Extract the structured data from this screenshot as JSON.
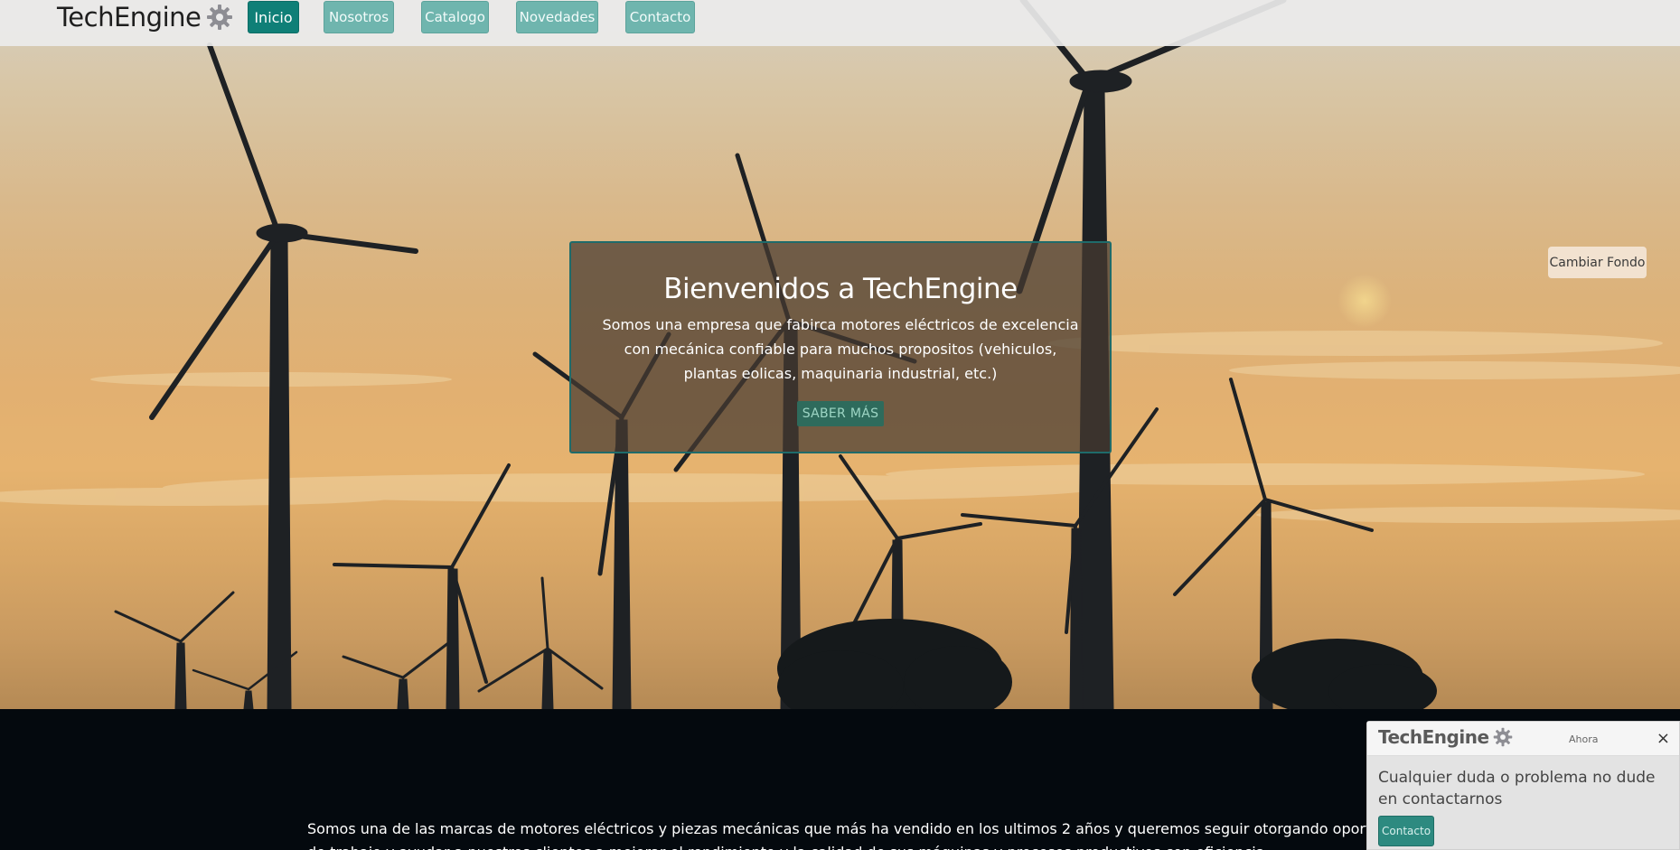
{
  "brand": {
    "name": "TechEngine",
    "icon": "gear-icon"
  },
  "nav": {
    "items": [
      {
        "label": "Inicio",
        "active": true
      },
      {
        "label": "Nosotros",
        "active": false
      },
      {
        "label": "Catalogo",
        "active": false
      },
      {
        "label": "Novedades",
        "active": false
      },
      {
        "label": "Contacto",
        "active": false
      }
    ]
  },
  "hero": {
    "title": "Bienvenidos a TechEngine",
    "description": "Somos una empresa que fabirca motores eléctricos de excelencia con mecánica confiable para muchos propositos (vehiculos, plantas eolicas, maquinaria industrial, etc.)",
    "cta_label": "SABER MÁS",
    "change_bg_label": "Cambiar Fondo"
  },
  "about": {
    "line1": "Somos una de las marcas de motores eléctricos y piezas mecánicas que más ha vendido en los ultimos 2 años y queremos seguir otorgando oportunidades",
    "line2": "de trabajo y ayudar a nuestros clientes a mejorar el rendimiento y la calidad de sus máquinas y procesos productivos con eficiencia."
  },
  "toast": {
    "brand": "TechEngine",
    "time": "Ahora",
    "close": "×",
    "message": "Cualquier duda o problema no dude en contactarnos",
    "button_label": "Contacto"
  },
  "colors": {
    "accent": "#0f7f77",
    "nav_button": "#6fb5ae",
    "dark_section": "#04090e"
  }
}
